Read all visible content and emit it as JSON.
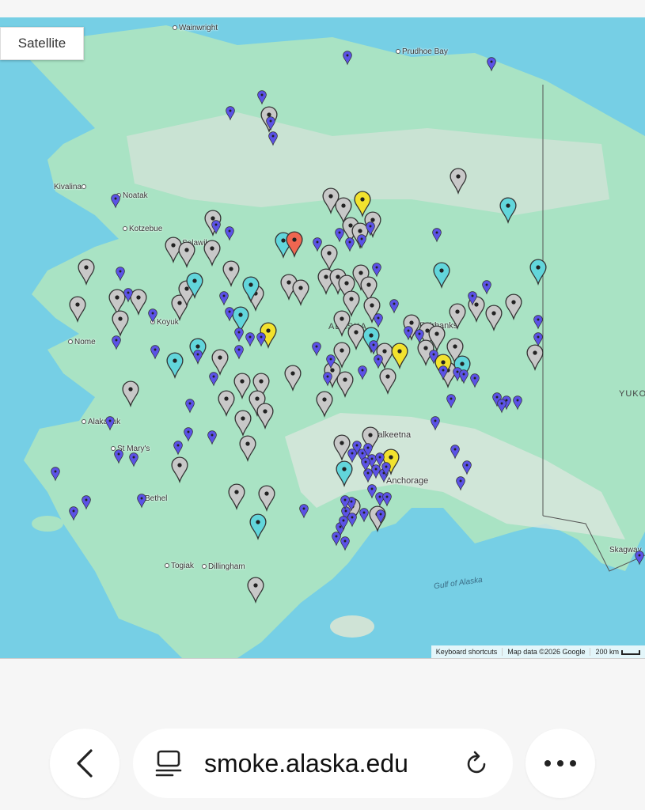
{
  "map": {
    "type_control_label": "Satellite",
    "places": [
      {
        "name": "Wainwright",
        "type": "town"
      },
      {
        "name": "Prudhoe Bay",
        "type": "town"
      },
      {
        "name": "Kivalina",
        "type": "town"
      },
      {
        "name": "Noatak",
        "type": "town"
      },
      {
        "name": "Kotzebue",
        "type": "town"
      },
      {
        "name": "Selawik",
        "type": "town"
      },
      {
        "name": "Koyuk",
        "type": "town"
      },
      {
        "name": "Nome",
        "type": "town"
      },
      {
        "name": "Alakanuk",
        "type": "town"
      },
      {
        "name": "St Mary's",
        "type": "town"
      },
      {
        "name": "Bethel",
        "type": "town"
      },
      {
        "name": "Togiak",
        "type": "town"
      },
      {
        "name": "Dillingham",
        "type": "town"
      },
      {
        "name": "Skagway",
        "type": "town"
      },
      {
        "name": "ALASKA",
        "type": "region"
      },
      {
        "name": "YUKON",
        "type": "region"
      },
      {
        "name": "Talkeetna",
        "type": "town"
      },
      {
        "name": "Anchorage",
        "type": "city"
      },
      {
        "name": "Fairbanks",
        "type": "city"
      }
    ],
    "water_label": "Gulf of Alaska",
    "attribution": {
      "shortcuts": "Keyboard shortcuts",
      "data": "Map data ©2026 Google",
      "scale": "200 km"
    },
    "marker_colors": {
      "gray": "#c8c8c8",
      "blue": "#5b52e6",
      "cyan": "#62d6db",
      "yellow": "#f2e22e",
      "red": "#ef6651"
    }
  },
  "browser": {
    "back_icon": "chevron-left-icon",
    "site_icon": "reader-mode-icon",
    "url": "smoke.alaska.edu",
    "reload_icon": "reload-icon",
    "more_icon": "more-dots-icon"
  }
}
